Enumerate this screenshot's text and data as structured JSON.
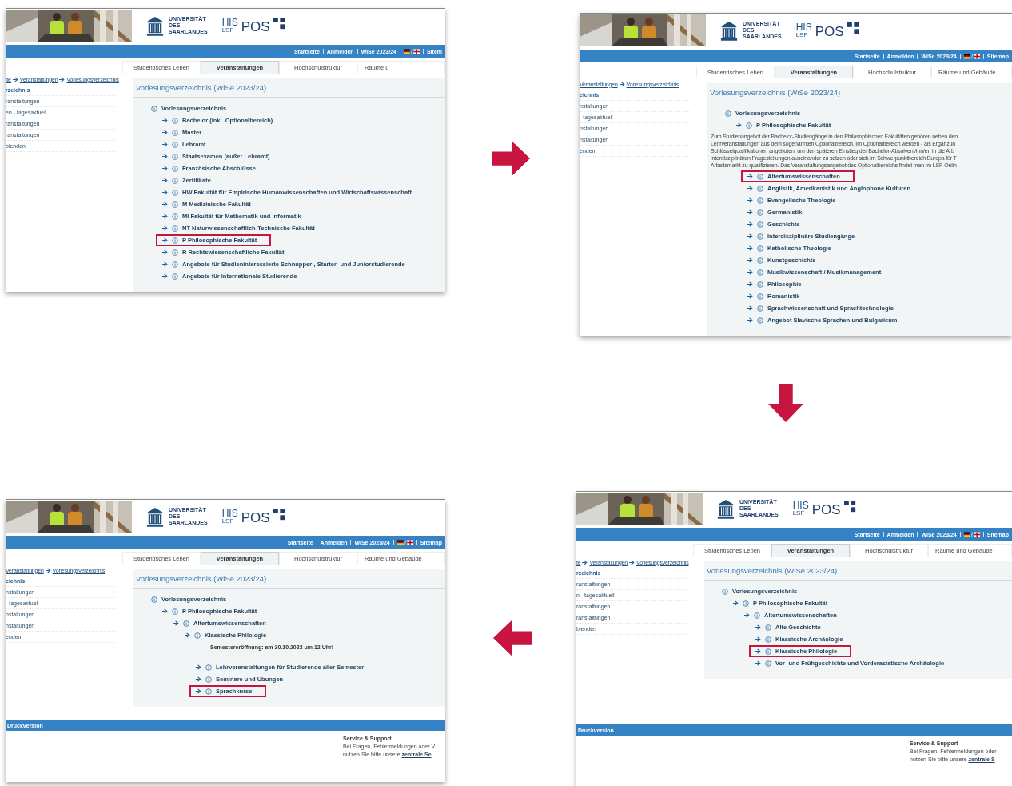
{
  "panels": [
    {
      "university_name_lines": [
        "UNIVERSITÄT",
        "DES",
        "SAARLANDES"
      ],
      "his": "HIS",
      "lsf": "LSF",
      "pos": "POS",
      "top_links": [
        "Startseite",
        "Anmelden",
        "WiSe 2023/24",
        "Sitem"
      ],
      "tabs": [
        {
          "label": "Studentisches Leben",
          "selected": false
        },
        {
          "label": "Veranstaltungen",
          "selected": true
        },
        {
          "label": "Hochschulstruktur",
          "selected": false
        },
        {
          "label": "Räume u",
          "selected": false
        }
      ],
      "breadcrumbs": [
        "ite",
        "Veranstaltungen",
        "Vorlesungsverzeichnis"
      ],
      "sidebar": [
        {
          "label": "rzeichnis",
          "selected": true
        },
        {
          "label": "ranstaltungen",
          "selected": false
        },
        {
          "label": "en - tagesaktuell",
          "selected": false
        },
        {
          "label": "ranstaltungen",
          "selected": false
        },
        {
          "label": "ranstaltungen",
          "selected": false
        },
        {
          "label": "blenden",
          "selected": false
        }
      ],
      "title": "Vorlesungsverzeichnis (WiSe 2023/24)",
      "tree": [
        {
          "label": "Vorlesungsverzeichnis",
          "highlighted": false,
          "children": [
            {
              "label": "Bachelor (inkl. Optionalbereich)",
              "highlighted": false
            },
            {
              "label": "Master",
              "highlighted": false
            },
            {
              "label": "Lehramt",
              "highlighted": false
            },
            {
              "label": "Staatsexamen (außer Lehramt)",
              "highlighted": false
            },
            {
              "label": "Französische Abschlüsse",
              "highlighted": false
            },
            {
              "label": "Zertifikate",
              "highlighted": false
            },
            {
              "label": "HW Fakultät für Empirische Humanwissenschaften und Wirtschaftswissenschaft",
              "highlighted": false
            },
            {
              "label": "M Medizinische Fakultät",
              "highlighted": false
            },
            {
              "label": "MI Fakultät für Mathematik und Informatik",
              "highlighted": false
            },
            {
              "label": "NT Naturwissenschaftlich-Technische Fakultät",
              "highlighted": false
            },
            {
              "label": "P Philosophische Fakultät",
              "highlighted": true
            },
            {
              "label": "R Rechtswissenschaftliche Fakultät",
              "highlighted": false
            },
            {
              "label": "Angebote für Studieninteressierte Schnupper-, Starter- und Juniorstudierende",
              "highlighted": false
            },
            {
              "label": "Angebote für internationale Studierende",
              "highlighted": false
            }
          ]
        }
      ]
    },
    {
      "university_name_lines": [
        "UNIVERSITÄT",
        "DES",
        "SAARLANDES"
      ],
      "his": "HIS",
      "lsf": "LSF",
      "pos": "POS",
      "top_links": [
        "Startseite",
        "Anmelden",
        "WiSe 2023/24",
        "Sitemap"
      ],
      "tabs": [
        {
          "label": "Studentisches Leben",
          "selected": false
        },
        {
          "label": "Veranstaltungen",
          "selected": true
        },
        {
          "label": "Hochschulstruktur",
          "selected": false
        },
        {
          "label": "Räume und Gebäude",
          "selected": false
        }
      ],
      "breadcrumbs": [
        "Veranstaltungen",
        "Vorlesungsverzeichnis"
      ],
      "sidebar": [
        {
          "label": "eichnis",
          "selected": true
        },
        {
          "label": "nstaltungen",
          "selected": false
        },
        {
          "label": "- tagesaktuell",
          "selected": false
        },
        {
          "label": "nstaltungen",
          "selected": false
        },
        {
          "label": "nstaltungen",
          "selected": false
        },
        {
          "label": "enden",
          "selected": false
        }
      ],
      "title": "Vorlesungsverzeichnis (WiSe 2023/24)",
      "tree": [
        {
          "label": "Vorlesungsverzeichnis",
          "highlighted": false,
          "children": [
            {
              "label": "P Philosophische Fakultät",
              "highlighted": false,
              "description_lines": [
                "Zum Studienangebot der Bachelor-Studiengänge in den Philosophischen Fakultäten gehören neben den",
                "Lehrveranstaltungen aus dem sogenannten Optionalbereich. Im Optionalbereich werden - als Ergänzun",
                "Schlüsselqualifikationen angeboten, um den späteren Einstieg der Bachelor-Absolvent/inn/en in die Arb",
                "interdisziplinären Fragestellungen auseinander zu setzen oder sich im Schwerpunktbereich Europa für T",
                "Arbeitsmarkt zu qualifizieren. Das Veranstaltungsangebot des Optionalbereichs findet man im LSF-Onlin"
              ],
              "children": [
                {
                  "label": "Altertumswissenschaften",
                  "highlighted": true
                },
                {
                  "label": "Anglistik, Amerikanistik und Anglophone Kulturen",
                  "highlighted": false
                },
                {
                  "label": "Evangelische Theologie",
                  "highlighted": false
                },
                {
                  "label": "Germanistik",
                  "highlighted": false
                },
                {
                  "label": "Geschichte",
                  "highlighted": false
                },
                {
                  "label": "Interdisziplinäre Studiengänge",
                  "highlighted": false
                },
                {
                  "label": "Katholische Theologie",
                  "highlighted": false
                },
                {
                  "label": "Kunstgeschichte",
                  "highlighted": false
                },
                {
                  "label": "Musikwissenschaft / Musikmanagement",
                  "highlighted": false
                },
                {
                  "label": "Philosophie",
                  "highlighted": false
                },
                {
                  "label": "Romanistik",
                  "highlighted": false
                },
                {
                  "label": "Sprachwissenschaft und Sprachtechnologie",
                  "highlighted": false
                },
                {
                  "label": "Angebot Slavische Sprachen und Bulgaricum",
                  "highlighted": false
                }
              ]
            }
          ]
        }
      ]
    },
    {
      "university_name_lines": [
        "UNIVERSITÄT",
        "DES",
        "SAARLANDES"
      ],
      "his": "HIS",
      "lsf": "LSF",
      "pos": "POS",
      "top_links": [
        "Startseite",
        "Anmelden",
        "WiSe 2023/24",
        "Sitemap"
      ],
      "tabs": [
        {
          "label": "Studentisches Leben",
          "selected": false
        },
        {
          "label": "Veranstaltungen",
          "selected": true
        },
        {
          "label": "Hochschulstruktur",
          "selected": false
        },
        {
          "label": "Räume und Gebäude",
          "selected": false
        }
      ],
      "breadcrumbs": [
        "Veranstaltungen",
        "Vorlesungsverzeichnis"
      ],
      "sidebar": [
        {
          "label": "eichnis",
          "selected": true
        },
        {
          "label": "nstaltungen",
          "selected": false
        },
        {
          "label": "- tagesaktuell",
          "selected": false
        },
        {
          "label": "nstaltungen",
          "selected": false
        },
        {
          "label": "nstaltungen",
          "selected": false
        },
        {
          "label": "enden",
          "selected": false
        }
      ],
      "title": "Vorlesungsverzeichnis (WiSe 2023/24)",
      "tree": [
        {
          "label": "Vorlesungsverzeichnis",
          "highlighted": false,
          "children": [
            {
              "label": "P Philosophische Fakultät",
              "highlighted": false,
              "children": [
                {
                  "label": "Altertumswissenschaften",
                  "highlighted": false,
                  "children": [
                    {
                      "label": "Klassische Philologie",
                      "highlighted": false,
                      "note": "Semestereröffnung: am 30.10.2023 um 12 Uhr!",
                      "children": [
                        {
                          "label": "Lehrveranstaltungen für Studierende aller Semester",
                          "highlighted": false
                        },
                        {
                          "label": "Seminare und Übungen",
                          "highlighted": false
                        },
                        {
                          "label": "Sprachkurse",
                          "highlighted": true
                        }
                      ]
                    }
                  ]
                }
              ]
            }
          ]
        }
      ],
      "footer": {
        "bar": "Druckversion",
        "heading": "Service & Support",
        "lines": [
          "Bei Fragen, Fehlermeldungen oder V"
        ],
        "last_line": "nutzen Sie bitte unsere",
        "link": "zentrale Se"
      }
    },
    {
      "university_name_lines": [
        "UNIVERSITÄT",
        "DES",
        "SAARLANDES"
      ],
      "his": "HIS",
      "lsf": "LSF",
      "pos": "POS",
      "top_links": [
        "Startseite",
        "Anmelden",
        "WiSe 2023/24",
        "Sitemap"
      ],
      "tabs": [
        {
          "label": "Studentisches Leben",
          "selected": false
        },
        {
          "label": "Veranstaltungen",
          "selected": true
        },
        {
          "label": "Hochschulstruktur",
          "selected": false
        },
        {
          "label": "Räume und Gebäude",
          "selected": false
        }
      ],
      "breadcrumbs": [
        "te",
        "Veranstaltungen",
        "Vorlesungsverzeichnis"
      ],
      "sidebar": [
        {
          "label": "rzeichnis",
          "selected": true
        },
        {
          "label": "ranstaltungen",
          "selected": false
        },
        {
          "label": "n - tagesaktuell",
          "selected": false
        },
        {
          "label": "ranstaltungen",
          "selected": false
        },
        {
          "label": "ranstaltungen",
          "selected": false
        },
        {
          "label": "blenden",
          "selected": false
        }
      ],
      "title": "Vorlesungsverzeichnis (WiSe 2023/24)",
      "tree": [
        {
          "label": "Vorlesungsverzeichnis",
          "highlighted": false,
          "children": [
            {
              "label": "P Philosophische Fakultät",
              "highlighted": false,
              "children": [
                {
                  "label": "Altertumswissenschaften",
                  "highlighted": false,
                  "children": [
                    {
                      "label": "Alte Geschichte",
                      "highlighted": false
                    },
                    {
                      "label": "Klassische Archäologie",
                      "highlighted": false
                    },
                    {
                      "label": "Klassische Philologie",
                      "highlighted": true
                    },
                    {
                      "label": "Vor- und Frühgeschichte und Vorderasiatische Archäologie",
                      "highlighted": false
                    }
                  ]
                }
              ]
            }
          ]
        }
      ],
      "footer": {
        "bar": "Druckversion",
        "heading": "Service & Support",
        "lines": [
          "Bei Fragen, Fehlermeldungen oder"
        ],
        "last_line": "nutzen Sie bitte unsere",
        "link": "zentrale S"
      }
    }
  ]
}
